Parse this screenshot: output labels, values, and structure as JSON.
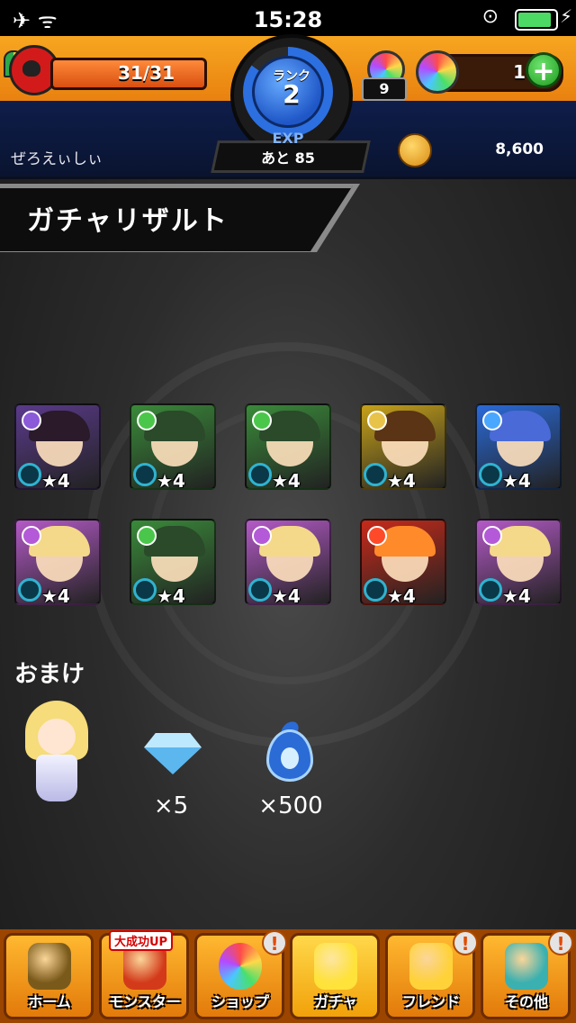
{
  "status_bar": {
    "time": "15:28",
    "left_icons": "✈ ᯤ"
  },
  "header": {
    "stamina": {
      "current": 31,
      "max": 31,
      "text": "31/31",
      "fill_fraction": 1.0
    },
    "rank": {
      "label": "ランク",
      "value": "2"
    },
    "exp": {
      "title": "EXP",
      "remaining": "あと 85"
    },
    "orb_pack_count": "9",
    "orbs": "1",
    "player_name": "ぜろえぃしぃ",
    "coins": "8,600"
  },
  "page": {
    "title": "ガチャリザルト"
  },
  "results": [
    {
      "name": "monster-1",
      "rarity": "★4",
      "bg": "#5a3a8a",
      "hair": "#2a1a2a",
      "attr": "#8a5ad8"
    },
    {
      "name": "monster-2",
      "rarity": "★4",
      "bg": "#3a8a3a",
      "hair": "#2a4a2a",
      "attr": "#4ac74a"
    },
    {
      "name": "monster-3",
      "rarity": "★4",
      "bg": "#3a8a3a",
      "hair": "#2a4a2a",
      "attr": "#4ac74a"
    },
    {
      "name": "monster-4",
      "rarity": "★4",
      "bg": "#c7a21a",
      "hair": "#5a3414",
      "attr": "#e8c34a"
    },
    {
      "name": "monster-5",
      "rarity": "★4",
      "bg": "#2a6ad8",
      "hair": "#4a6ad8",
      "attr": "#4aa7ff"
    },
    {
      "name": "monster-6",
      "rarity": "★4",
      "bg": "#b45ac7",
      "hair": "#f4d98a",
      "attr": "#b45ad8"
    },
    {
      "name": "monster-7",
      "rarity": "★4",
      "bg": "#3a8a3a",
      "hair": "#2a4a2a",
      "attr": "#4ac74a"
    },
    {
      "name": "monster-8",
      "rarity": "★4",
      "bg": "#b45ac7",
      "hair": "#f4d98a",
      "attr": "#b45ad8"
    },
    {
      "name": "monster-9",
      "rarity": "★4",
      "bg": "#c72a1a",
      "hair": "#ff8a2a",
      "attr": "#ff4a2a"
    },
    {
      "name": "monster-10",
      "rarity": "★4",
      "bg": "#b45ac7",
      "hair": "#f4d98a",
      "attr": "#b45ad8"
    }
  ],
  "bonus": {
    "title": "おまけ",
    "items": [
      {
        "icon": "gem-icon",
        "label": "×5"
      },
      {
        "icon": "soul-flame-icon",
        "label": "×500"
      }
    ]
  },
  "nav": [
    {
      "label": "ホーム",
      "icon": "home-gate-icon",
      "badge": "",
      "tag": "",
      "color": "#7a5a1a"
    },
    {
      "label": "モンスター",
      "icon": "monster-icon",
      "badge": "",
      "tag": "大成功UP",
      "color": "#d33a1a"
    },
    {
      "label": "ショップ",
      "icon": "orb-icon",
      "badge": "!",
      "tag": "",
      "color": "#6ac7ff"
    },
    {
      "label": "ガチャ",
      "icon": "gacha-egg-icon",
      "badge": "",
      "tag": "",
      "color": "#ffe23a"
    },
    {
      "label": "フレンド",
      "icon": "friends-icon",
      "badge": "!",
      "tag": "",
      "color": "#ffd23a"
    },
    {
      "label": "その他",
      "icon": "other-menu-icon",
      "badge": "!",
      "tag": "",
      "color": "#3ab0b0"
    }
  ]
}
